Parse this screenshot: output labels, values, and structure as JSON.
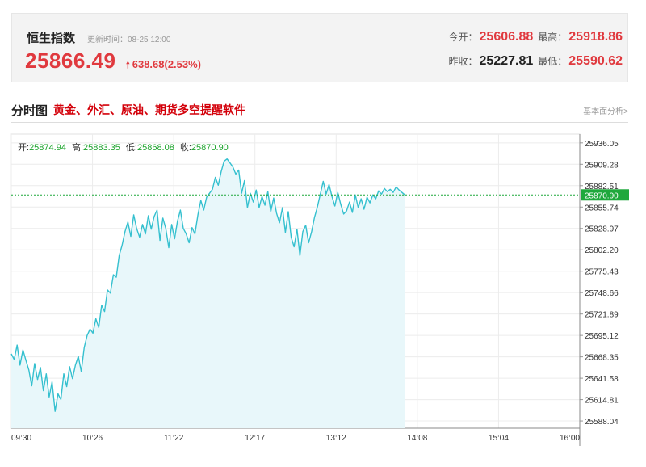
{
  "header": {
    "name": "恒生指数",
    "update_time": "更新时间：08-25 12:00",
    "price": "25866.49",
    "change": "638.68(2.53%)",
    "change_direction": "up",
    "open_label": "今开：",
    "open_value": "25606.88",
    "high_label": "最高：",
    "high_value": "25918.86",
    "prev_close_label": "昨收：",
    "prev_close_value": "25227.81",
    "low_label": "最低：",
    "low_value": "25590.62"
  },
  "section": {
    "title": "分时图",
    "promo_link": "黄金、外汇、原油、期货多空提醒软件",
    "fundamental_link": "基本面分析>"
  },
  "ohlc": {
    "open_label": "开:",
    "open_value": "25874.94",
    "high_label": "高:",
    "high_value": "25883.35",
    "low_label": "低:",
    "low_value": "25868.08",
    "close_label": "收:",
    "close_value": "25870.90"
  },
  "colors": {
    "up": "#e0393e",
    "line": "#35c0cf",
    "fill": "#e8f7fa",
    "current_marker": "#1fa83c"
  },
  "chart_data": {
    "type": "line",
    "x_ticks": [
      "09:30",
      "10:26",
      "11:22",
      "12:17",
      "13:12",
      "14:08",
      "15:04",
      "16:00"
    ],
    "y_ticks": [
      "25936.05",
      "25909.28",
      "25882.51",
      "25855.74",
      "25828.97",
      "25802.20",
      "25775.43",
      "25748.66",
      "25721.89",
      "25695.12",
      "25668.35",
      "25641.58",
      "25614.81",
      "25588.04"
    ],
    "ylim": [
      25579,
      25947
    ],
    "current_value": "25870.90",
    "grid": true,
    "x_unit": "minutes from 09:30",
    "xlim": [
      0,
      390
    ],
    "series": [
      {
        "values": [
          [
            0,
            25672
          ],
          [
            2,
            25665
          ],
          [
            4,
            25683
          ],
          [
            6,
            25658
          ],
          [
            8,
            25677
          ],
          [
            10,
            25664
          ],
          [
            12,
            25652
          ],
          [
            14,
            25632
          ],
          [
            16,
            25660
          ],
          [
            18,
            25640
          ],
          [
            20,
            25655
          ],
          [
            22,
            25626
          ],
          [
            24,
            25647
          ],
          [
            26,
            25618
          ],
          [
            28,
            25637
          ],
          [
            30,
            25600
          ],
          [
            32,
            25622
          ],
          [
            34,
            25615
          ],
          [
            36,
            25647
          ],
          [
            38,
            25631
          ],
          [
            40,
            25656
          ],
          [
            42,
            25641
          ],
          [
            44,
            25658
          ],
          [
            46,
            25669
          ],
          [
            48,
            25650
          ],
          [
            50,
            25680
          ],
          [
            52,
            25695
          ],
          [
            54,
            25703
          ],
          [
            56,
            25698
          ],
          [
            58,
            25716
          ],
          [
            60,
            25705
          ],
          [
            62,
            25733
          ],
          [
            64,
            25725
          ],
          [
            66,
            25752
          ],
          [
            68,
            25748
          ],
          [
            70,
            25771
          ],
          [
            72,
            25768
          ],
          [
            74,
            25795
          ],
          [
            76,
            25808
          ],
          [
            78,
            25825
          ],
          [
            80,
            25837
          ],
          [
            82,
            25819
          ],
          [
            84,
            25846
          ],
          [
            86,
            25829
          ],
          [
            88,
            25818
          ],
          [
            90,
            25834
          ],
          [
            92,
            25822
          ],
          [
            94,
            25845
          ],
          [
            96,
            25828
          ],
          [
            98,
            25844
          ],
          [
            100,
            25852
          ],
          [
            102,
            25814
          ],
          [
            104,
            25842
          ],
          [
            106,
            25829
          ],
          [
            108,
            25805
          ],
          [
            110,
            25834
          ],
          [
            112,
            25816
          ],
          [
            114,
            25838
          ],
          [
            116,
            25852
          ],
          [
            118,
            25829
          ],
          [
            120,
            25822
          ],
          [
            122,
            25811
          ],
          [
            124,
            25830
          ],
          [
            126,
            25822
          ],
          [
            128,
            25846
          ],
          [
            130,
            25864
          ],
          [
            132,
            25852
          ],
          [
            134,
            25868
          ],
          [
            136,
            25873
          ],
          [
            138,
            25878
          ],
          [
            140,
            25893
          ],
          [
            142,
            25883
          ],
          [
            144,
            25900
          ],
          [
            146,
            25913
          ],
          [
            148,
            25916
          ],
          [
            150,
            25911
          ],
          [
            152,
            25906
          ],
          [
            154,
            25897
          ],
          [
            156,
            25902
          ],
          [
            158,
            25873
          ],
          [
            160,
            25889
          ],
          [
            162,
            25855
          ],
          [
            164,
            25873
          ],
          [
            166,
            25862
          ],
          [
            168,
            25877
          ],
          [
            170,
            25855
          ],
          [
            172,
            25869
          ],
          [
            174,
            25858
          ],
          [
            176,
            25875
          ],
          [
            178,
            25850
          ],
          [
            180,
            25867
          ],
          [
            182,
            25848
          ],
          [
            184,
            25836
          ],
          [
            186,
            25855
          ],
          [
            188,
            25824
          ],
          [
            190,
            25850
          ],
          [
            192,
            25818
          ],
          [
            194,
            25806
          ],
          [
            196,
            25828
          ],
          [
            198,
            25795
          ],
          [
            200,
            25825
          ],
          [
            202,
            25833
          ],
          [
            204,
            25811
          ],
          [
            206,
            25825
          ],
          [
            208,
            25843
          ],
          [
            210,
            25856
          ],
          [
            212,
            25872
          ],
          [
            214,
            25888
          ],
          [
            216,
            25872
          ],
          [
            218,
            25884
          ],
          [
            220,
            25869
          ],
          [
            222,
            25857
          ],
          [
            224,
            25874
          ],
          [
            226,
            25859
          ],
          [
            228,
            25847
          ],
          [
            230,
            25851
          ],
          [
            232,
            25862
          ],
          [
            234,
            25849
          ],
          [
            236,
            25871
          ],
          [
            238,
            25855
          ],
          [
            240,
            25866
          ],
          [
            242,
            25853
          ],
          [
            244,
            25868
          ],
          [
            246,
            25861
          ],
          [
            248,
            25871
          ],
          [
            250,
            25866
          ],
          [
            252,
            25876
          ],
          [
            254,
            25872
          ],
          [
            256,
            25879
          ],
          [
            258,
            25875
          ],
          [
            260,
            25878
          ],
          [
            262,
            25874
          ],
          [
            264,
            25881
          ],
          [
            266,
            25877
          ],
          [
            268,
            25874
          ],
          [
            270,
            25871
          ]
        ]
      }
    ]
  }
}
